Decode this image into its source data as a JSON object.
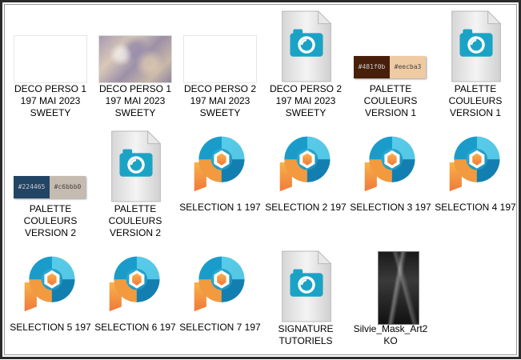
{
  "colors": {
    "psp_blue": "#1f9fc4",
    "psp_orange": "#f7a045",
    "palette1_a": "#481f0b",
    "palette1_b": "#eecba3",
    "palette2_a": "#224465",
    "palette2_b": "#c6bbb0"
  },
  "files": [
    {
      "label": "DECO PERSO 1\n197 MAI 2023\nSWEETY",
      "thumb": "blank-image"
    },
    {
      "label": "DECO PERSO 1\n197 MAI 2023\nSWEETY",
      "thumb": "texture-image"
    },
    {
      "label": "DECO PERSO 2\n197 MAI 2023\nSWEETY",
      "thumb": "blank-image"
    },
    {
      "label": "DECO PERSO 2\n197 MAI 2023\nSWEETY",
      "thumb": "psp-document-icon"
    },
    {
      "label": "PALETTE\nCOULEURS\nVERSION 1",
      "thumb": "palette-image",
      "swatch_a": "#481f0b",
      "swatch_b": "#eecba3"
    },
    {
      "label": "PALETTE\nCOULEURS\nVERSION 1",
      "thumb": "psp-document-icon"
    },
    {
      "label": "PALETTE\nCOULEURS\nVERSION 2",
      "thumb": "palette-image",
      "swatch_a": "#224465",
      "swatch_b": "#c6bbb0"
    },
    {
      "label": "PALETTE\nCOULEURS\nVERSION 2",
      "thumb": "psp-document-icon"
    },
    {
      "label": "SELECTION 1 197",
      "thumb": "psp-logo-icon"
    },
    {
      "label": "SELECTION 2 197",
      "thumb": "psp-logo-icon"
    },
    {
      "label": "SELECTION 3 197",
      "thumb": "psp-logo-icon"
    },
    {
      "label": "SELECTION 4 197",
      "thumb": "psp-logo-icon"
    },
    {
      "label": "SELECTION 5 197",
      "thumb": "psp-logo-icon"
    },
    {
      "label": "SELECTION 6 197",
      "thumb": "psp-logo-icon"
    },
    {
      "label": "SELECTION 7 197",
      "thumb": "psp-logo-icon"
    },
    {
      "label": "SIGNATURE\nTUTORIELS",
      "thumb": "psp-document-icon"
    },
    {
      "label": "Silvie_Mask_Art2\nKO",
      "thumb": "dark-mask-image"
    }
  ]
}
